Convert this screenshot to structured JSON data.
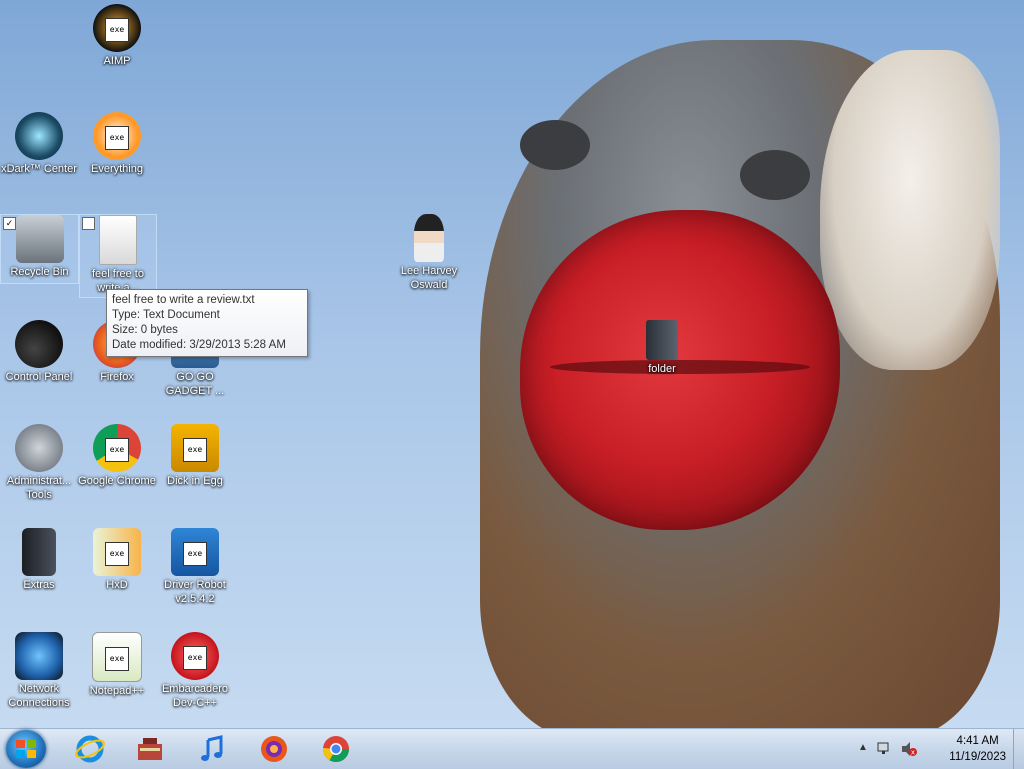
{
  "desktop_icons": [
    {
      "id": "aimp",
      "label": "AIMP"
    },
    {
      "id": "xdark",
      "label": "xDark™ Center"
    },
    {
      "id": "everything",
      "label": "Everything"
    },
    {
      "id": "recycle",
      "label": "Recycle Bin"
    },
    {
      "id": "feelfree",
      "label": "feel free to write a..."
    },
    {
      "id": "lee",
      "label": "Lee Harvey Oswald"
    },
    {
      "id": "control",
      "label": "Control Panel"
    },
    {
      "id": "firefox",
      "label": "Firefox"
    },
    {
      "id": "gogo",
      "label": "GO GO GADGET ..."
    },
    {
      "id": "folder",
      "label": "folder"
    },
    {
      "id": "admin",
      "label": "Administrat... Tools"
    },
    {
      "id": "chrome",
      "label": "Google Chrome"
    },
    {
      "id": "dick",
      "label": "Dick in Egg"
    },
    {
      "id": "extras",
      "label": "Extras"
    },
    {
      "id": "hxd",
      "label": "HxD"
    },
    {
      "id": "driver",
      "label": "Driver Robot v2.5.4.2"
    },
    {
      "id": "network",
      "label": "Network Connections"
    },
    {
      "id": "notepad",
      "label": "Notepad++"
    },
    {
      "id": "devcpp",
      "label": "Embarcadero Dev-C++"
    }
  ],
  "tooltip": {
    "line1": "feel free to write a review.txt",
    "line2": "Type: Text Document",
    "line3": "Size: 0 bytes",
    "line4": "Date modified: 3/29/2013 5:28 AM"
  },
  "taskbar": {
    "pinned": [
      "internet-explorer-icon",
      "toolbox-icon",
      "music-note-icon",
      "firefox-icon",
      "chrome-icon"
    ],
    "clock_time": "4:41 AM",
    "clock_date": "11/19/2023"
  },
  "doc_badge_text": "exe",
  "checkmark": "✓",
  "colors": {
    "accent": "#1f6fb9",
    "tooltip_border": "#767676",
    "lips": "#c81e26"
  }
}
